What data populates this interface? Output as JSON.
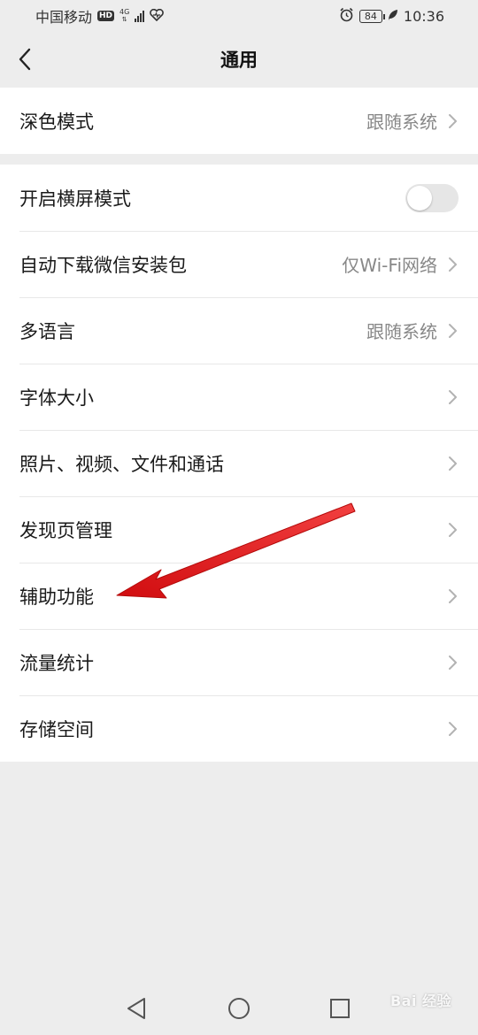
{
  "status_bar": {
    "carrier": "中国移动",
    "hd": "HD",
    "network": "4G",
    "battery": "84",
    "time": "10:36"
  },
  "header": {
    "title": "通用"
  },
  "group1": {
    "dark_mode": {
      "label": "深色模式",
      "value": "跟随系统"
    }
  },
  "group2": {
    "landscape": {
      "label": "开启横屏模式",
      "enabled": false
    },
    "auto_download": {
      "label": "自动下载微信安装包",
      "value": "仅Wi-Fi网络"
    },
    "language": {
      "label": "多语言",
      "value": "跟随系统"
    },
    "font_size": {
      "label": "字体大小"
    },
    "media": {
      "label": "照片、视频、文件和通话"
    },
    "discover": {
      "label": "发现页管理"
    },
    "accessibility": {
      "label": "辅助功能"
    },
    "traffic": {
      "label": "流量统计"
    },
    "storage": {
      "label": "存储空间"
    }
  },
  "annotation": {
    "arrow_color": "#e0191b"
  },
  "watermark": "Bai 经验",
  "icons": [
    "back-icon",
    "chevron-right-icon",
    "alarm-icon",
    "heart-icon",
    "leaf-icon",
    "nav-back-icon",
    "nav-home-icon",
    "nav-recents-icon"
  ]
}
